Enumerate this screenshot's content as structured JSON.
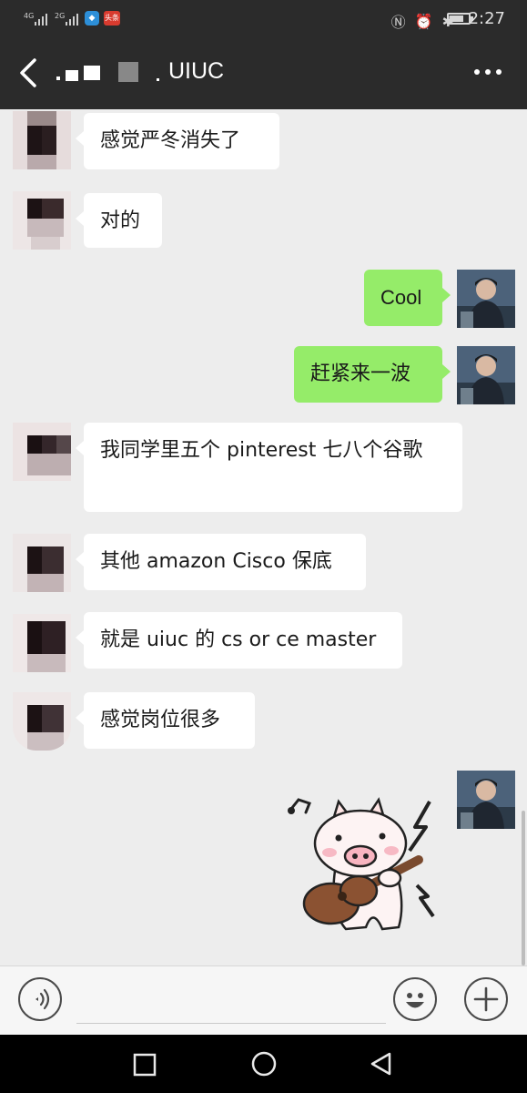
{
  "status_bar": {
    "signal_1": "4G",
    "signal_2": "2G",
    "app_badge_red": "头条",
    "time": "2:27",
    "battery_level": 0.75
  },
  "nav": {
    "title": "UIUC",
    "back_icon": "chevron-left-icon",
    "more_icon": "more-dots-icon"
  },
  "messages": [
    {
      "side": "left",
      "text": "感觉严冬消失了"
    },
    {
      "side": "left",
      "text": "对的"
    },
    {
      "side": "right",
      "text": "Cool"
    },
    {
      "side": "right",
      "text": "赶紧来一波"
    },
    {
      "side": "left",
      "text": "我同学里五个 pinterest 七八个谷歌"
    },
    {
      "side": "left",
      "text": "其他 amazon Cisco 保底"
    },
    {
      "side": "left",
      "text": "就是 uiuc 的 cs or ce master"
    },
    {
      "side": "left",
      "text": "感觉岗位很多"
    },
    {
      "side": "right",
      "type": "sticker",
      "sticker": "pig-playing-guitar-sticker"
    }
  ],
  "input_bar": {
    "voice_icon": "voice-icon",
    "emoji_icon": "emoji-icon",
    "plus_icon": "plus-icon",
    "placeholder": ""
  },
  "colors": {
    "header_bg": "#2b2b2b",
    "chat_bg": "#ededed",
    "bubble_self": "#95ec69",
    "bubble_other": "#ffffff"
  }
}
